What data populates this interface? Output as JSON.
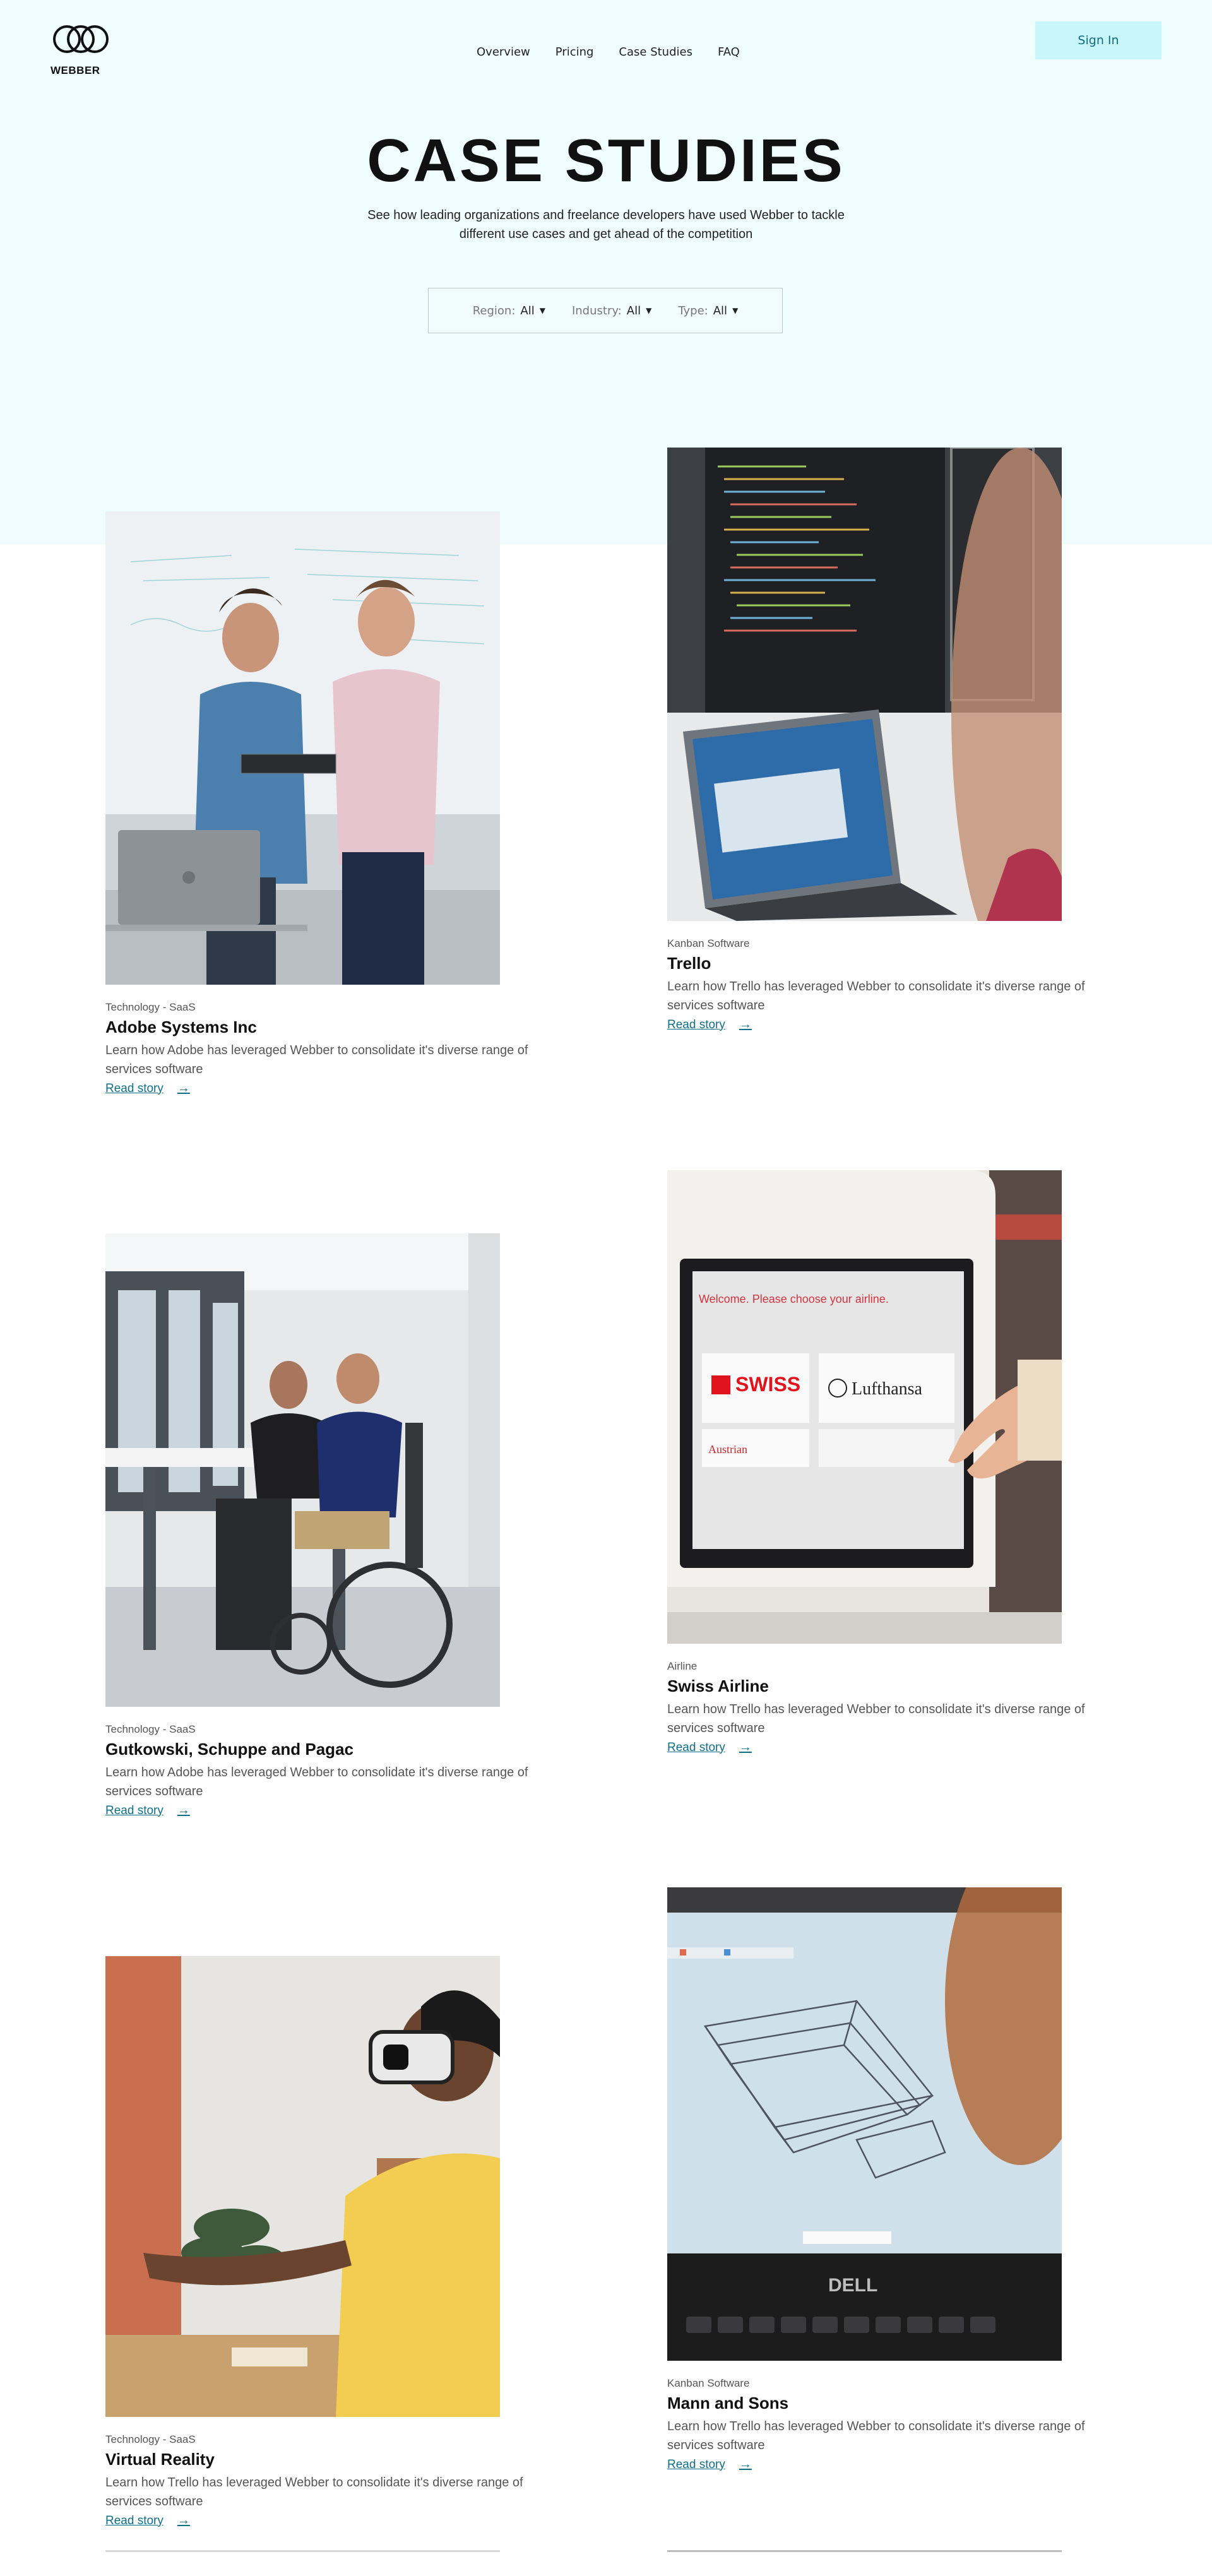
{
  "brand": {
    "name": "WEBBER",
    "logo_icon": "interlocking-rings-icon"
  },
  "nav": {
    "items": [
      {
        "label": "Overview"
      },
      {
        "label": "Pricing"
      },
      {
        "label": "Case Studies"
      },
      {
        "label": "FAQ"
      }
    ],
    "signin_label": "Sign In"
  },
  "hero": {
    "title": "CASE STUDIES",
    "subtitle": "See how leading organizations and freelance developers have used Webber to tackle different use cases and get ahead of the competition"
  },
  "filters": [
    {
      "label": "Region:",
      "value": "All"
    },
    {
      "label": "Industry:",
      "value": "All"
    },
    {
      "label": "Type:",
      "value": "All"
    }
  ],
  "cards": [
    {
      "category": "Technology - SaaS",
      "title": "Adobe Systems Inc",
      "description": "Learn how Adobe has leveraged Webber to consolidate it's diverse range of services software",
      "link": "Read story",
      "image": "two men with laptop at whiteboard"
    },
    {
      "category": "Kanban Software",
      "title": "Trello",
      "description": "Learn how Trello has leveraged Webber to consolidate it's diverse range of services software",
      "link": "Read story",
      "image": "monitor with code and laptop"
    },
    {
      "category": "Technology - SaaS",
      "title": "Gutkowski, Schuppe and Pagac",
      "description": "Learn how Adobe has leveraged Webber to consolidate it's diverse range of services software",
      "link": "Read story",
      "image": "man in wheelchair in office"
    },
    {
      "category": "Airline",
      "title": "Swiss Airline",
      "description": "Learn how Trello has leveraged Webber to consolidate it's diverse range of services software",
      "link": "Read story",
      "image": "airline check-in kiosk"
    },
    {
      "category": "Technology - SaaS",
      "title": "Virtual Reality",
      "description": "Learn how Trello has leveraged Webber to consolidate it's diverse range of services software",
      "link": "Read story",
      "image": "person wearing VR headset"
    },
    {
      "category": "Kanban Software",
      "title": "Mann and Sons",
      "description": "Learn how Trello has leveraged Webber to consolidate it's diverse range of services software",
      "link": "Read story",
      "image": "3D model on laptop screen"
    }
  ],
  "kiosk_text": {
    "welcome": "Welcome. Please choose your airline.",
    "swiss": "SWISS",
    "lufthansa": "Lufthansa",
    "austrian": "Austrian"
  },
  "laptop_brand": "DELL",
  "colors": {
    "hero_bg": "#effdfe",
    "accent": "#0f6f86",
    "signin_bg": "#c9f6fb"
  }
}
